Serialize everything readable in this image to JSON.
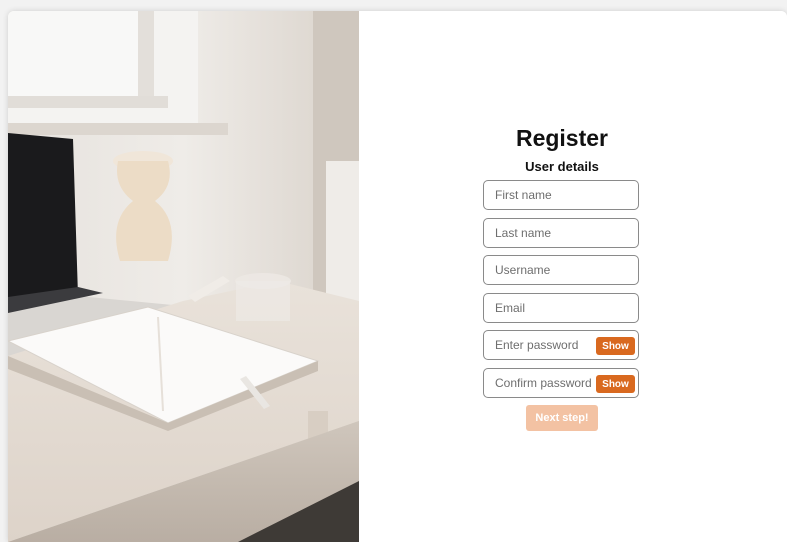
{
  "form": {
    "title": "Register",
    "subtitle": "User details",
    "fields": {
      "first_name": {
        "placeholder": "First name",
        "value": ""
      },
      "last_name": {
        "placeholder": "Last name",
        "value": ""
      },
      "username": {
        "placeholder": "Username",
        "value": ""
      },
      "email": {
        "placeholder": "Email",
        "value": ""
      },
      "password": {
        "placeholder": "Enter password",
        "value": "",
        "toggle_label": "Show"
      },
      "confirm_password": {
        "placeholder": "Confirm password",
        "value": "",
        "toggle_label": "Show"
      }
    },
    "next_label": "Next step!",
    "next_disabled": true
  },
  "colors": {
    "accent": "#d9691f",
    "accent_disabled": "#f3c2a3",
    "field_border": "#8a8a8a"
  },
  "image": {
    "description_icon": "desk-photo-image"
  }
}
